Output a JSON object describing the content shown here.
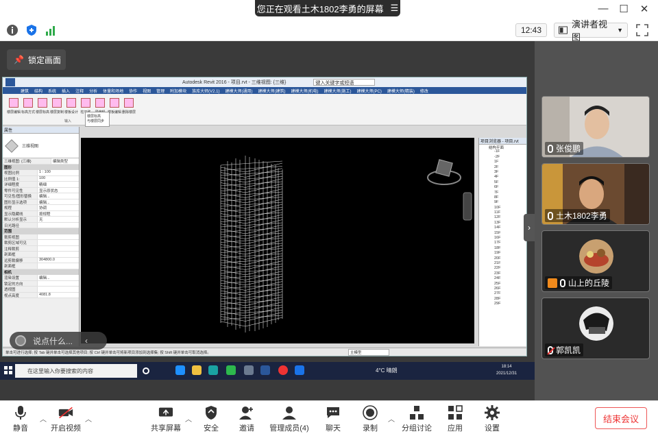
{
  "title_bar": {
    "share_banner": "您正在观看土木1802李勇的屏幕",
    "menu_icon": "menu-lines-icon",
    "min": "—",
    "max": "☐",
    "close": "✕"
  },
  "status_row": {
    "clock": "12:43",
    "view_mode": "演讲者视图"
  },
  "share": {
    "lock_label": "锁定画面",
    "say_placeholder": "说点什么...",
    "revit": {
      "title": "Autodesk Revit 2016 -  项目.rvt - 三维视图: {三维}",
      "search_placeholder": "键入关键字或短语",
      "menu": [
        "建筑",
        "结构",
        "系统",
        "插入",
        "注释",
        "分析",
        "体量和场地",
        "协作",
        "视图",
        "管理",
        "附加模块",
        "族库大师(V2.1)",
        "建模大师(通用)",
        "建模大师(建筑)",
        "建模大师(机电)",
        "建模大师(施工)",
        "建模大师(PC)",
        "建模大师(精装)",
        "修改"
      ],
      "ribbon": [
        "楼层编辑",
        "标高方式",
        "楼层标高",
        "楼层复制",
        "楼板设计",
        "柱平移",
        "梁编辑",
        "楼板编辑",
        "删除楼层"
      ],
      "ribbon_group": "输入",
      "dropdown": [
        "楼层标高",
        "与楼层同步"
      ],
      "properties_title": "属性",
      "type_name": "三维视图",
      "view_selector": "三维视图: {三维}",
      "edit_type": "编辑类型",
      "properties": [
        {
          "group": "图形"
        },
        {
          "k": "视图比例",
          "v": "1 : 100"
        },
        {
          "k": "比例值 1:",
          "v": "100"
        },
        {
          "k": "详细程度",
          "v": "精细"
        },
        {
          "k": "零件可见性",
          "v": "显示原状态"
        },
        {
          "k": "可见性/图形替换",
          "v": "编辑..."
        },
        {
          "k": "图形显示选项",
          "v": "编辑..."
        },
        {
          "k": "规程",
          "v": "协调"
        },
        {
          "k": "显示隐藏线",
          "v": "按规程"
        },
        {
          "k": "默认分析显示",
          "v": "无"
        },
        {
          "k": "日光路径",
          "v": ""
        },
        {
          "group": "范围"
        },
        {
          "k": "裁剪视图",
          "v": ""
        },
        {
          "k": "裁剪区域可见",
          "v": ""
        },
        {
          "k": "注释裁剪",
          "v": ""
        },
        {
          "k": "剖面框",
          "v": ""
        },
        {
          "k": "远剪裁偏移",
          "v": "304800.0"
        },
        {
          "k": "剖面框",
          "v": ""
        },
        {
          "group": "相机"
        },
        {
          "k": "渲染设置",
          "v": "编辑..."
        },
        {
          "k": "锁定的方向",
          "v": ""
        },
        {
          "k": "透视图",
          "v": ""
        },
        {
          "k": "视点高度",
          "v": "4081.8"
        }
      ],
      "browser_title": "项目浏览器 - 项目.rvt",
      "browser_items": [
        "结构平面",
        "-1F",
        "-2F",
        "1F",
        "2F",
        "3F",
        "4F",
        "5F",
        "6F",
        "7F",
        "8F",
        "9F",
        "10F",
        "11F",
        "12F",
        "13F",
        "14F",
        "15F",
        "16F",
        "17F",
        "18F",
        "19F",
        "20F",
        "21F",
        "22F",
        "23F",
        "24F",
        "25F",
        "26F",
        "27F",
        "28F",
        "29F"
      ],
      "status_text": "单击可进行选择; 按 Tab 键并单击可选择其他项目; 按 Ctrl 键并单击可将新项目添加到选择集; 按 Shift 键并单击可取消选择。",
      "status_model": "主模型"
    },
    "taskbar": {
      "search_placeholder": "在这里输入你要搜索的内容",
      "weather": "4°C 晴朗",
      "time": "18:14",
      "date": "2021/12/31"
    }
  },
  "participants": [
    {
      "name": "张俊鹏",
      "muted": false,
      "kind": "video"
    },
    {
      "name": "土木1802李勇",
      "muted": false,
      "kind": "video"
    },
    {
      "name": "山上的丘陵",
      "muted": false,
      "kind": "avatar"
    },
    {
      "name": "郭凯凯",
      "muted": true,
      "kind": "avatar"
    }
  ],
  "toolbar": {
    "mute": "静音",
    "video": "开启视频",
    "share_screen": "共享屏幕",
    "security": "安全",
    "invite": "邀请",
    "manage": "管理成员(4)",
    "chat": "聊天",
    "record": "录制",
    "breakout": "分组讨论",
    "apps": "应用",
    "settings": "设置",
    "end": "结束会议"
  },
  "colors": {
    "end_red": "#e33333",
    "accent_blue": "#2b579a",
    "banner": "#2d2d2d"
  }
}
